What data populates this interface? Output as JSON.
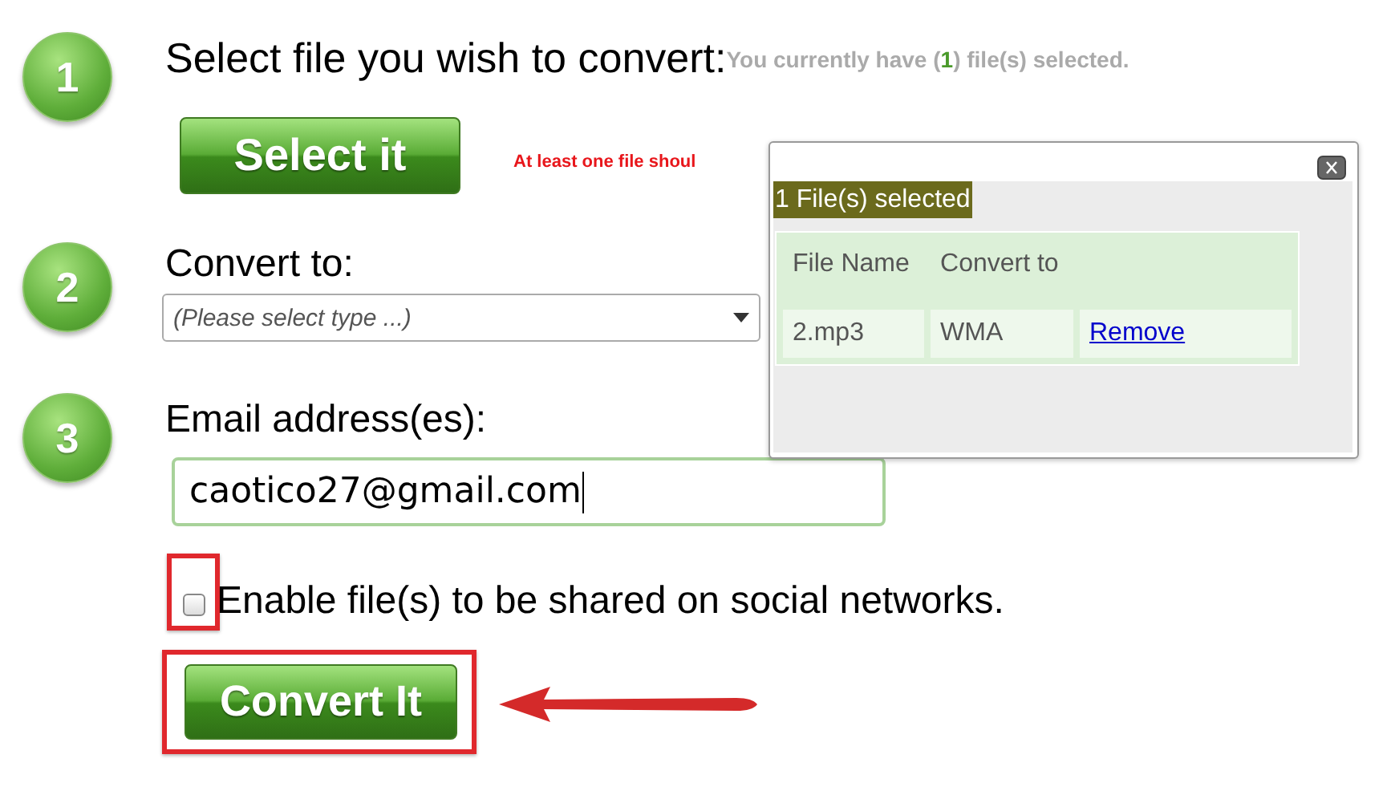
{
  "steps": [
    {
      "number": "1",
      "title": "Select file you wish to convert:"
    },
    {
      "number": "2",
      "title": "Convert to:"
    },
    {
      "number": "3",
      "title": "Email address(es):"
    }
  ],
  "selection_note": {
    "before": "You currently have (",
    "count": "1",
    "after": ") file(s) selected."
  },
  "select_button": {
    "label": "Select it"
  },
  "warning": "At least one file shoul",
  "convert_to": {
    "placeholder": "(Please select type ...)"
  },
  "email": {
    "value": "caotico27@gmail.com"
  },
  "share": {
    "label": "Enable file(s) to be shared on social networks.",
    "checked": false
  },
  "convert_button": {
    "label": "Convert It"
  },
  "popup": {
    "header": "1 File(s) selected",
    "columns": [
      "File Name",
      "Convert to"
    ],
    "rows": [
      {
        "file_name": "2.mp3",
        "convert_to": "WMA",
        "action": "Remove"
      }
    ]
  }
}
